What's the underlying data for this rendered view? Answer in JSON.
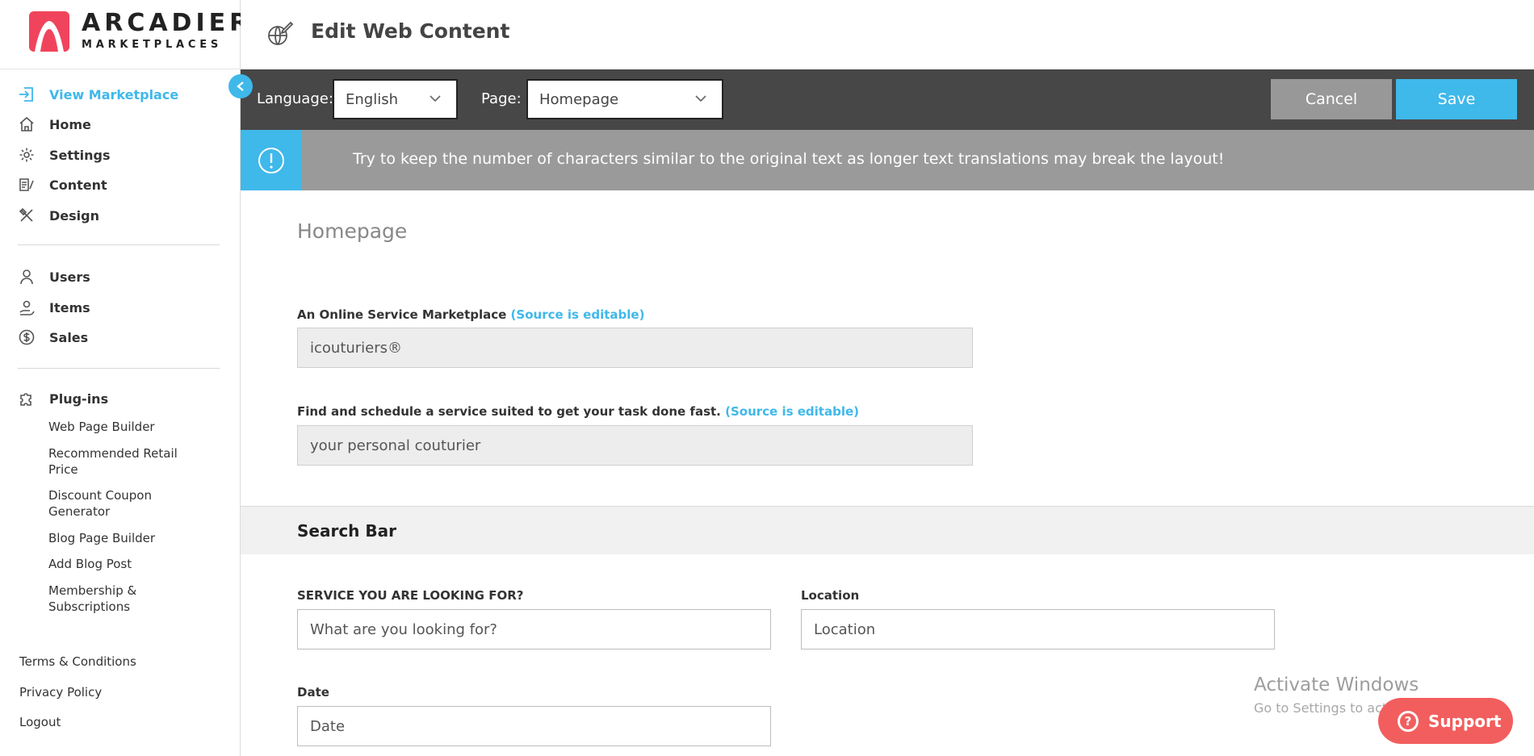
{
  "brand": {
    "line1": "ARCADIER",
    "line2": "MARKETPLACES",
    "accent_color": "#f0445d"
  },
  "sidebar": {
    "collapse_icon": "chevron-left-icon",
    "items": [
      {
        "label": "View Marketplace",
        "icon": "sign-in-icon",
        "active": true
      },
      {
        "label": "Home",
        "icon": "home-icon"
      },
      {
        "label": "Settings",
        "icon": "gear-icon"
      },
      {
        "label": "Content",
        "icon": "content-icon"
      },
      {
        "label": "Design",
        "icon": "design-tools-icon"
      },
      {
        "label": "Users",
        "icon": "user-icon"
      },
      {
        "label": "Items",
        "icon": "items-icon"
      },
      {
        "label": "Sales",
        "icon": "dollar-icon"
      },
      {
        "label": "Plug-ins",
        "icon": "puzzle-icon"
      }
    ],
    "plugins": [
      "Web Page Builder",
      "Recommended Retail Price",
      "Discount Coupon Generator",
      "Blog Page Builder",
      "Add Blog Post",
      "Membership & Subscriptions"
    ],
    "footer": [
      "Terms & Conditions",
      "Privacy Policy",
      "Logout"
    ]
  },
  "header": {
    "title": "Edit Web Content",
    "icon": "edit-globe-icon"
  },
  "toolbar": {
    "language_label": "Language:",
    "language_value": "English",
    "page_label": "Page:",
    "page_value": "Homepage",
    "cancel_label": "Cancel",
    "save_label": "Save",
    "accent_color": "#3fb8ea"
  },
  "notice": {
    "icon": "exclamation-icon",
    "text": "Try to keep the number of characters similar to the original text as longer text translations may break the layout!"
  },
  "main": {
    "section_title": "Homepage",
    "fields": [
      {
        "label": "An Online Service Marketplace",
        "editable_note": "(Source is editable)",
        "value": "icouturiers®"
      },
      {
        "label": "Find and schedule a service suited to get your task done fast.",
        "editable_note": "(Source is editable)",
        "value": "your personal couturier"
      }
    ],
    "search_bar": {
      "title": "Search Bar",
      "service_label": "SERVICE YOU ARE LOOKING FOR?",
      "service_value": "What are you looking for?",
      "location_label": "Location",
      "location_value": "Location",
      "date_label": "Date",
      "date_value": "Date"
    }
  },
  "watermark": {
    "line1": "Activate Windows",
    "line2": "Go to Settings to activate Windows."
  },
  "support": {
    "label": "Support",
    "icon": "question-icon",
    "color": "#f25e5e"
  }
}
